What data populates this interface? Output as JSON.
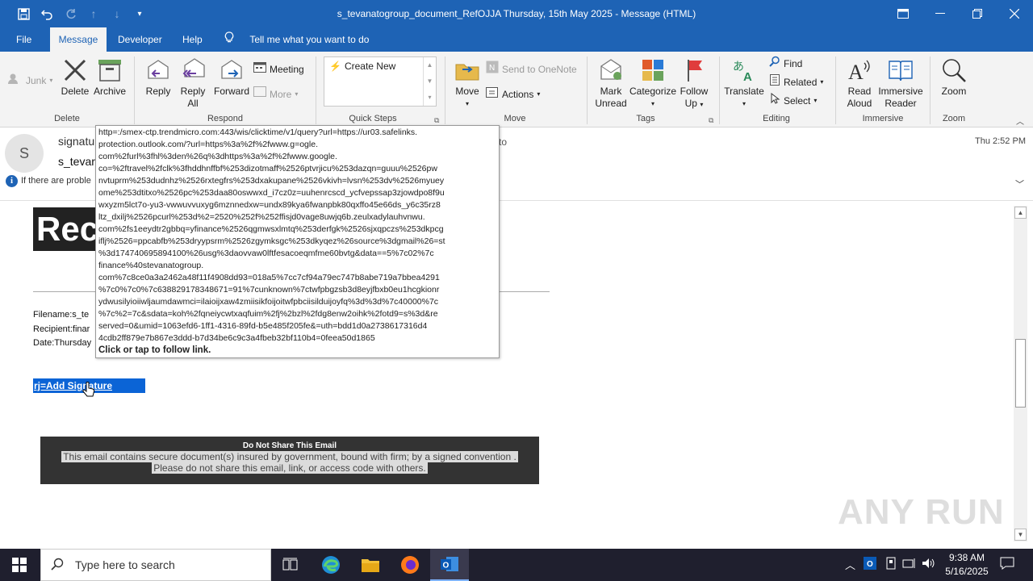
{
  "window": {
    "title": "s_tevanatogroup_document_RefOJJA Thursday, 15th May 2025  -  Message (HTML)"
  },
  "menu": {
    "tabs": [
      "File",
      "Message",
      "Developer",
      "Help"
    ],
    "tell_me": "Tell me what you want to do"
  },
  "ribbon": {
    "delete_group": {
      "label": "Delete",
      "junk": "Junk",
      "delete": "Delete",
      "archive": "Archive"
    },
    "respond_group": {
      "label": "Respond",
      "reply": "Reply",
      "reply_all_1": "Reply",
      "reply_all_2": "All",
      "forward": "Forward",
      "meeting": "Meeting",
      "more": "More"
    },
    "quick_steps": {
      "label": "Quick Steps",
      "create_new": "Create New"
    },
    "move_group": {
      "label": "Move",
      "move": "Move",
      "send_onenote": "Send to OneNote",
      "actions": "Actions"
    },
    "tags_group": {
      "label": "Tags",
      "mark_unread_1": "Mark",
      "mark_unread_2": "Unread",
      "categorize": "Categorize",
      "follow_up_1": "Follow",
      "follow_up_2": "Up"
    },
    "editing_group": {
      "label": "Editing",
      "translate": "Translate",
      "find": "Find",
      "related": "Related",
      "select": "Select"
    },
    "immersive_group": {
      "label": "Immersive",
      "read_aloud_1": "Read",
      "read_aloud_2": "Aloud",
      "reader_1": "Immersive",
      "reader_2": "Reader"
    },
    "zoom_group": {
      "label": "Zoom",
      "zoom": "Zoom"
    }
  },
  "header": {
    "avatar_letter": "S",
    "sender_partial": "signatu",
    "subject_partial": "s_tevar",
    "to_partial": "to",
    "info_partial": "If there are proble",
    "received": "Thu 2:52 PM"
  },
  "body": {
    "banner": "Rec",
    "meta": [
      "Filename:s_te",
      "Recipient:finar",
      "Date:Thursday"
    ],
    "signature_link": "rj=Add Signature",
    "notice_title": "Do Not Share This Email",
    "notice_line1": "This email contains secure document(s) insured by government, bound with firm; by a signed convention .",
    "notice_line2": "Please do not share this email, link, or access code with others."
  },
  "tooltip": {
    "lines": [
      "http=:/smex-ctp.trendmicro.com:443/wis/clicktime/v1/query?url=https://ur03.safelinks.",
      "protection.outlook.com/?url=https%3a%2f%2fwww.g=ogle.",
      "com%2furl%3fhl%3den%26q%3dhttps%3a%2f%2fwww.google.",
      "co=%2ftravel%2fclk%3fhddhnffbf%253dizotmaff%2526ptvrjicu%253dazqn=guuu%2526pw",
      "nvtuprm%253dudnhz%2526rxtegfrs%253dxakupane%2526vkivh=lvsn%253dv%2526myuey",
      "ome%253dtitxo%2526pc%253daa80oswwxd_i7cz0z=uuhenrcscd_ycfvepssap3zjowdpo8f9u",
      "wxyzm5lct7o-yu3-vwwuvvuxyg6mznnedxw=undx89kya6fwanpbk80qxffo45e66ds_y6c35rz8",
      "ltz_dxilj%2526pcurl%253d%2=2520%252f%252ffisjd0vage8uwjq6b.zeulxadylauhvnwu.",
      "com%2fs1eeydtr2gbbq=yfinance%2526qgmwsxlmtq%253derfgk%2526sjxqpczs%253dkpcg",
      "iflj%2526=ppcabfb%253dryypsrm%2526zgymksgc%253dkyqez%26source%3dgmail%26=st",
      "%3d174740695894100%26usg%3daovvaw0lftfesacoeqmfme60bvtg&data==5%7c02%7c",
      "finance%40stevanatogroup.",
      "com%7c8ce0a3a2462a48f11f4908dd93=018a5%7cc7cf94a79ec747b8abe719a7bbea4291",
      "%7c0%7c0%7c638829178348671=91%7cunknown%7ctwfpbgzsb3d8eyjfbxb0eu1hcgkionr",
      "ydwusilyioiiwljaumdawmci=ilaioijxaw4zmiisikfoijoitwfpbciisilduijoyfq%3d%3d%7c40000%7c",
      "%7c%2=7c&sdata=koh%2fqneiycwtxaqfuim%2fj%2bzl%2fdg8enw2oihk%2fotd9=s%3d&re",
      "served=0&umid=1063efd6-1ff1-4316-89fd-b5e485f205fe&=uth=bdd1d0a2738617316d4",
      "4cdb2ff879e7b867e3ddd-b7d34be6c9c3a4fbeb32bf110b4=0feea50d1865"
    ],
    "follow": "Click or tap to follow link."
  },
  "taskbar": {
    "search_placeholder": "Type here to search",
    "time": "9:38 AM",
    "date": "5/16/2025"
  },
  "watermark": "ANY RUN",
  "colors": {
    "accent": "#1e63b5",
    "taskbar": "#1f1f2e",
    "link_highlight": "#0b64d6"
  }
}
